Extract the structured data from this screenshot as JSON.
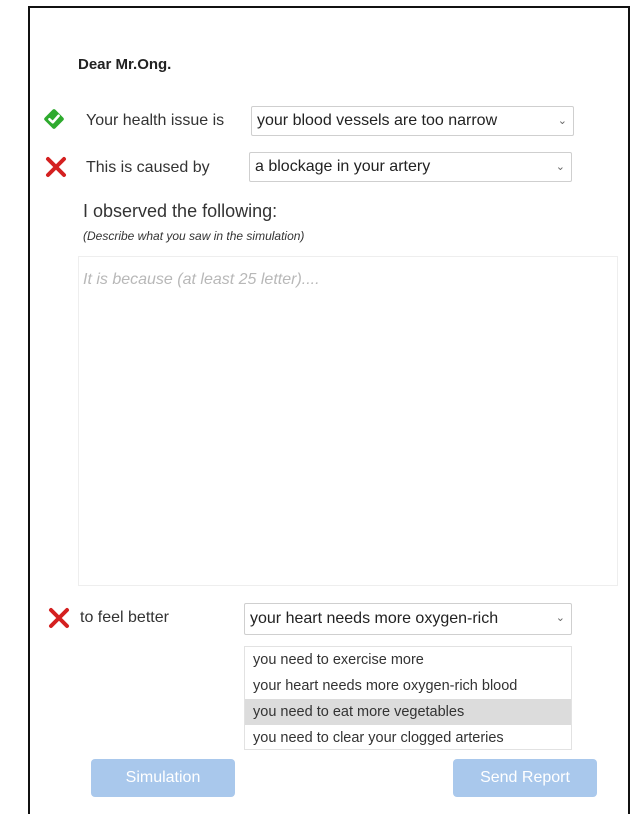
{
  "letter": {
    "greeting": "Dear Mr.Ong."
  },
  "health_issue": {
    "status": "correct",
    "label": "Your health issue is",
    "selected": "your blood vessels are too narrow"
  },
  "cause": {
    "status": "incorrect",
    "label": "This is caused by",
    "selected": "a blockage in your artery"
  },
  "observation": {
    "title": "I observed the following:",
    "hint": "(Describe what you saw in the simulation)",
    "placeholder": "It is because (at least 25 letter)...."
  },
  "remedy": {
    "status": "incorrect",
    "label": "to feel better",
    "selected": "your heart needs more oxygen-rich",
    "options": [
      "you need to exercise more",
      "your heart needs more oxygen-rich blood",
      "you need to eat more vegetables",
      "you need to clear your clogged arteries"
    ],
    "highlighted_index": 2
  },
  "buttons": {
    "simulation": "Simulation",
    "send_report": "Send Report"
  },
  "icons": {
    "check": "check-icon",
    "cross": "x-icon",
    "chevron": "chevron-down-icon"
  },
  "colors": {
    "correct": "#2eaa2e",
    "incorrect": "#d42020",
    "button_bg": "#a9c8ec",
    "highlight": "#dcdcdc"
  }
}
